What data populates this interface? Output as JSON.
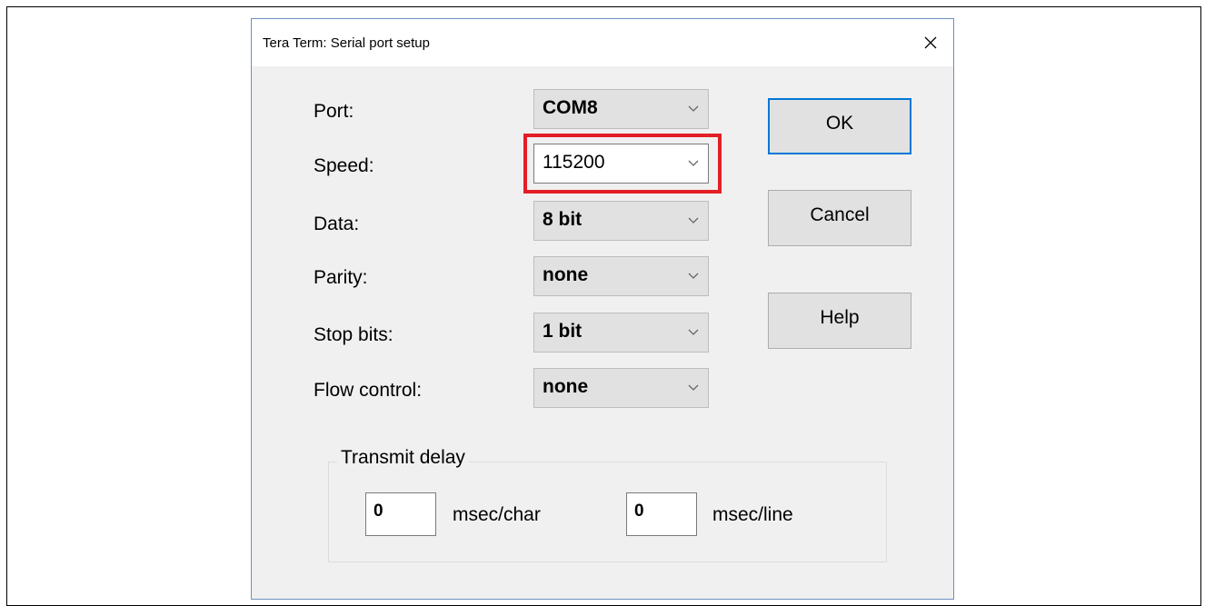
{
  "dialog": {
    "title": "Tera Term: Serial port setup"
  },
  "fields": [
    {
      "label": "Port:",
      "value": "COM8"
    },
    {
      "label": "Speed:",
      "value": "115200"
    },
    {
      "label": "Data:",
      "value": "8 bit"
    },
    {
      "label": "Parity:",
      "value": "none"
    },
    {
      "label": "Stop bits:",
      "value": "1 bit"
    },
    {
      "label": "Flow control:",
      "value": "none"
    }
  ],
  "buttons": {
    "ok": "OK",
    "cancel": "Cancel",
    "help": "Help"
  },
  "transmit_delay": {
    "group_label": "Transmit delay",
    "char_value": "0",
    "char_unit": "msec/char",
    "line_value": "0",
    "line_unit": "msec/line"
  },
  "icons": {
    "close": "close-icon",
    "dropdown": "chevron-down-icon"
  },
  "colors": {
    "highlight": "#e41e26",
    "dialog_border": "#6d8fbf",
    "default_button_border": "#0078d7"
  }
}
